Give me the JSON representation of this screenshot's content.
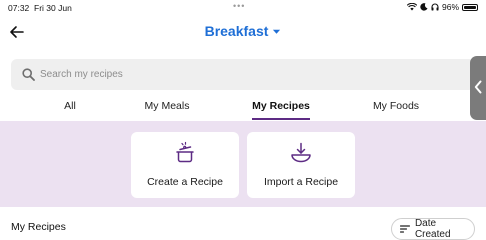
{
  "status_bar": {
    "time": "07:32",
    "date": "Fri 30 Jun",
    "dots": "•••",
    "battery": "96%",
    "battery_fraction": 0.96
  },
  "header": {
    "title": "Breakfast",
    "back_icon": "arrow-left-icon",
    "title_caret_icon": "caret-down-icon"
  },
  "search": {
    "placeholder": "Search my recipes",
    "value": "",
    "icon": "search-icon"
  },
  "side_tab": {
    "icon": "chevron-left-icon"
  },
  "tabs": [
    {
      "label": "All",
      "active": false
    },
    {
      "label": "My Meals",
      "active": false
    },
    {
      "label": "My Recipes",
      "active": true
    },
    {
      "label": "My Foods",
      "active": false
    }
  ],
  "actions": {
    "create": {
      "label": "Create a Recipe",
      "icon": "cooking-pot-icon"
    },
    "import": {
      "label": "Import a Recipe",
      "icon": "download-bowl-icon"
    }
  },
  "list": {
    "title": "My Recipes",
    "sort_label": "Date Created",
    "sort_icon": "sort-lines-icon"
  },
  "colors": {
    "accent": "#5d2b84",
    "title_blue": "#1f6fd6",
    "action_background": "#ece1f1",
    "search_background": "#efefef"
  }
}
